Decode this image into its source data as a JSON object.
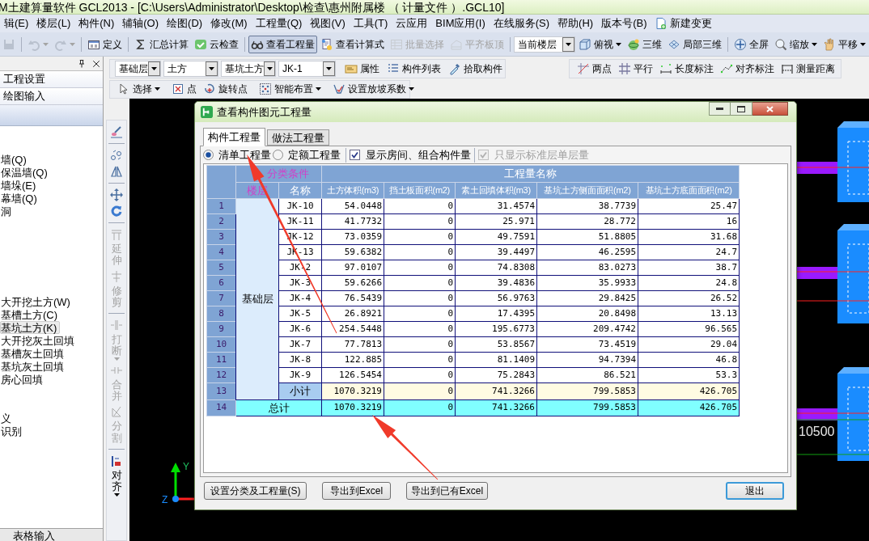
{
  "window": {
    "title": "M土建算量软件 GCL2013 - [C:\\Users\\Administrator\\Desktop\\检查\\惠州附属楼 （ 计量文件 ）.GCL10]"
  },
  "menu": {
    "items": [
      {
        "label": "辑(E)"
      },
      {
        "label": "楼层(L)"
      },
      {
        "label": "构件(N)"
      },
      {
        "label": "辅轴(O)"
      },
      {
        "label": "绘图(D)"
      },
      {
        "label": "修改(M)"
      },
      {
        "label": "工程量(Q)"
      },
      {
        "label": "视图(V)"
      },
      {
        "label": "工具(T)"
      },
      {
        "label": "云应用"
      },
      {
        "label": "BIM应用(I)"
      },
      {
        "label": "在线服务(S)"
      },
      {
        "label": "帮助(H)"
      },
      {
        "label": "版本号(B)"
      }
    ],
    "new_change": {
      "label": "新建变更"
    }
  },
  "toolbar_main": {
    "groups": [
      [
        {
          "kind": "icon",
          "disabled": true,
          "pressed": false,
          "dropdown": false
        }
      ],
      [
        {
          "kind": "icon",
          "disabled": true,
          "pressed": false,
          "dropdown": true
        },
        {
          "kind": "icon",
          "disabled": true,
          "pressed": false,
          "dropdown": true
        }
      ],
      [
        {
          "kind": "button",
          "label": "定义",
          "disabled": false,
          "pressed": false,
          "dropdown": false
        }
      ],
      [
        {
          "kind": "button",
          "label": "汇总计算",
          "disabled": false,
          "pressed": false,
          "dropdown": false
        },
        {
          "kind": "button",
          "label": "云检查",
          "disabled": false,
          "pressed": false,
          "dropdown": false
        }
      ],
      [
        {
          "kind": "button",
          "label": "查看工程量",
          "disabled": false,
          "pressed": true,
          "dropdown": false
        },
        {
          "kind": "button",
          "label": "查看计算式",
          "disabled": false,
          "pressed": false,
          "dropdown": false
        },
        {
          "kind": "button",
          "label": "批量选择",
          "disabled": true,
          "pressed": false,
          "dropdown": false
        },
        {
          "kind": "button",
          "label": "平齐板顶",
          "disabled": true,
          "pressed": false,
          "dropdown": false
        }
      ],
      [
        {
          "kind": "select",
          "value": "当前楼层"
        },
        {
          "kind": "button",
          "label": "俯视",
          "disabled": false,
          "pressed": false,
          "dropdown": true
        },
        {
          "kind": "button",
          "label": "三维",
          "disabled": false,
          "pressed": false,
          "dropdown": false
        },
        {
          "kind": "button",
          "label": "局部三维",
          "disabled": false,
          "pressed": false,
          "dropdown": false
        }
      ],
      [
        {
          "kind": "button",
          "label": "全屏",
          "disabled": false,
          "pressed": false,
          "dropdown": false
        },
        {
          "kind": "button",
          "label": "缩放",
          "disabled": false,
          "pressed": false,
          "dropdown": true
        },
        {
          "kind": "button",
          "label": "平移",
          "disabled": false,
          "pressed": false,
          "dropdown": true
        }
      ]
    ]
  },
  "toolbar_component": {
    "groups": [
      [
        {
          "kind": "select",
          "value": "基础层"
        },
        {
          "kind": "select",
          "value": "土方"
        },
        {
          "kind": "select",
          "value": "基坑土方"
        },
        {
          "kind": "select",
          "value": "JK-1"
        }
      ],
      [
        {
          "kind": "button",
          "label": "属性",
          "disabled": false,
          "pressed": false,
          "dropdown": false
        },
        {
          "kind": "button",
          "label": "构件列表",
          "disabled": false,
          "pressed": false,
          "dropdown": false
        },
        {
          "kind": "button",
          "label": "拾取构件",
          "disabled": false,
          "pressed": false,
          "dropdown": false
        }
      ]
    ]
  },
  "toolbar_measure": {
    "groups": [
      [
        {
          "kind": "button",
          "label": "两点",
          "disabled": false,
          "pressed": false,
          "dropdown": false
        },
        {
          "kind": "button",
          "label": "平行",
          "disabled": false,
          "pressed": false,
          "dropdown": false
        },
        {
          "kind": "button",
          "label": "长度标注",
          "disabled": false,
          "pressed": false,
          "dropdown": false
        },
        {
          "kind": "button",
          "label": "对齐标注",
          "disabled": false,
          "pressed": false,
          "dropdown": false
        },
        {
          "kind": "button",
          "label": "测量距离",
          "disabled": false,
          "pressed": false,
          "dropdown": false
        }
      ]
    ]
  },
  "toolbar_draw": {
    "groups": [
      [
        {
          "kind": "button",
          "label": "选择",
          "disabled": false,
          "pressed": false,
          "dropdown": true
        }
      ],
      [
        {
          "kind": "button",
          "label": "点",
          "disabled": false,
          "pressed": false,
          "dropdown": false
        },
        {
          "kind": "button",
          "label": "旋转点",
          "disabled": false,
          "pressed": false,
          "dropdown": false
        }
      ],
      [
        {
          "kind": "button",
          "label": "智能布置",
          "disabled": false,
          "pressed": false,
          "dropdown": true
        }
      ],
      [
        {
          "kind": "button",
          "label": "设置放坡系数",
          "disabled": false,
          "pressed": false,
          "dropdown": true
        }
      ]
    ]
  },
  "side_panel": {
    "nav": [
      {
        "label": "工程设置"
      },
      {
        "label": "绘图输入"
      }
    ],
    "tree_groups": [
      [
        {
          "label": "墙(Q)",
          "selected": false
        },
        {
          "label": "保温墙(Q)",
          "selected": false
        },
        {
          "label": "墙垛(E)",
          "selected": false
        },
        {
          "label": "幕墙(Q)",
          "selected": false
        },
        {
          "label": "洞",
          "selected": false
        }
      ],
      [
        {
          "label": "大开挖土方(W)",
          "selected": false
        },
        {
          "label": "基槽土方(C)",
          "selected": false
        },
        {
          "label": "基坑土方(K)",
          "selected": true
        },
        {
          "label": "大开挖灰土回填",
          "selected": false
        },
        {
          "label": "基槽灰土回填",
          "selected": false
        },
        {
          "label": "基坑灰土回填",
          "selected": false
        },
        {
          "label": "房心回填",
          "selected": false
        }
      ],
      [
        {
          "label": "义",
          "selected": false
        },
        {
          "label": "识别",
          "selected": false
        }
      ]
    ],
    "bottom_tab": {
      "label": "表格输入"
    }
  },
  "edit_toolbar": {
    "groups": [
      [
        {
          "kind": "icon",
          "disabled": false,
          "dropdown": false
        }
      ],
      [
        {
          "kind": "icon",
          "disabled": false,
          "dropdown": false
        },
        {
          "kind": "icon",
          "disabled": false,
          "dropdown": false
        }
      ],
      [
        {
          "kind": "icon",
          "disabled": false,
          "dropdown": false
        },
        {
          "kind": "icon",
          "disabled": false,
          "dropdown": false
        }
      ],
      [
        {
          "kind": "text",
          "label": "延伸",
          "disabled": true,
          "dropdown": false
        },
        {
          "kind": "text",
          "label": "修剪",
          "disabled": true,
          "dropdown": false
        }
      ],
      [
        {
          "kind": "text",
          "label": "打断",
          "disabled": true,
          "dropdown": true
        },
        {
          "kind": "text",
          "label": "合并",
          "disabled": true,
          "dropdown": false
        },
        {
          "kind": "text",
          "label": "分割",
          "disabled": true,
          "dropdown": false
        }
      ],
      [
        {
          "kind": "text",
          "label": "对齐",
          "disabled": false,
          "dropdown": true
        }
      ]
    ]
  },
  "canvas": {
    "dimension_label": "10500",
    "axis_labels": [
      "Y",
      "Z"
    ]
  },
  "dialog": {
    "title": "查看构件图元工程量",
    "tabs": [
      {
        "label": "构件工程量",
        "selected": true
      },
      {
        "label": "做法工程量",
        "selected": false
      }
    ],
    "radios": [
      {
        "label": "清单工程量",
        "selected": true
      },
      {
        "label": "定额工程量",
        "selected": false
      }
    ],
    "checkboxes": [
      {
        "label": "显示房间、组合构件量",
        "checked": true,
        "disabled": false
      },
      {
        "label": "只显示标准层单层量",
        "checked": true,
        "disabled": true
      }
    ],
    "table": {
      "group_headers": [
        "分类条件",
        "工程量名称"
      ],
      "columns": [
        "楼层",
        "名称",
        "土方体积(m3)",
        "挡土板面积(m2)",
        "素土回填体积(m3)",
        "基坑土方侧面面积(m2)",
        "基坑土方底面面积(m2)"
      ],
      "floor": "基础层",
      "rows": [
        {
          "kind": "item",
          "number": "1",
          "name": "JK-10",
          "values": [
            "54.0448",
            "0",
            "31.4574",
            "38.7739",
            "25.47"
          ]
        },
        {
          "kind": "item",
          "number": "2",
          "name": "JK-11",
          "values": [
            "41.7732",
            "0",
            "25.971",
            "28.772",
            "16"
          ]
        },
        {
          "kind": "item",
          "number": "3",
          "name": "JK-12",
          "values": [
            "73.0359",
            "0",
            "49.7591",
            "51.8805",
            "31.68"
          ]
        },
        {
          "kind": "item",
          "number": "4",
          "name": "JK-13",
          "values": [
            "59.6382",
            "0",
            "39.4497",
            "46.2595",
            "24.7"
          ]
        },
        {
          "kind": "item",
          "number": "5",
          "name": "JK-2",
          "values": [
            "97.0107",
            "0",
            "74.8308",
            "83.0273",
            "38.7"
          ]
        },
        {
          "kind": "item",
          "number": "6",
          "name": "JK-3",
          "values": [
            "59.6266",
            "0",
            "39.4836",
            "35.9933",
            "24.8"
          ]
        },
        {
          "kind": "item",
          "number": "7",
          "name": "JK-4",
          "values": [
            "76.5439",
            "0",
            "56.9763",
            "29.8425",
            "26.52"
          ]
        },
        {
          "kind": "item",
          "number": "8",
          "name": "JK-5",
          "values": [
            "26.8921",
            "0",
            "17.4395",
            "20.8498",
            "13.13"
          ]
        },
        {
          "kind": "item",
          "number": "9",
          "name": "JK-6",
          "values": [
            "254.5448",
            "0",
            "195.6773",
            "209.4742",
            "96.565"
          ]
        },
        {
          "kind": "item",
          "number": "10",
          "name": "JK-7",
          "values": [
            "77.7813",
            "0",
            "53.8567",
            "73.4519",
            "29.04"
          ]
        },
        {
          "kind": "item",
          "number": "11",
          "name": "JK-8",
          "values": [
            "122.885",
            "0",
            "81.1409",
            "94.7394",
            "46.8"
          ]
        },
        {
          "kind": "item",
          "number": "12",
          "name": "JK-9",
          "values": [
            "126.5454",
            "0",
            "75.2843",
            "86.521",
            "53.3"
          ]
        },
        {
          "kind": "subtotal",
          "number": "13",
          "name": "小计",
          "values": [
            "1070.3219",
            "0",
            "741.3266",
            "799.5853",
            "426.705"
          ]
        },
        {
          "kind": "total",
          "number": "14",
          "name": "总计",
          "values": [
            "1070.3219",
            "0",
            "741.3266",
            "799.5853",
            "426.705"
          ]
        }
      ]
    },
    "buttons": [
      {
        "label": "设置分类及工程量(S)",
        "default": false
      },
      {
        "label": "导出到Excel",
        "default": false
      },
      {
        "label": "导出到已有Excel",
        "default": false
      },
      {
        "label": "退出",
        "default": true
      }
    ]
  }
}
